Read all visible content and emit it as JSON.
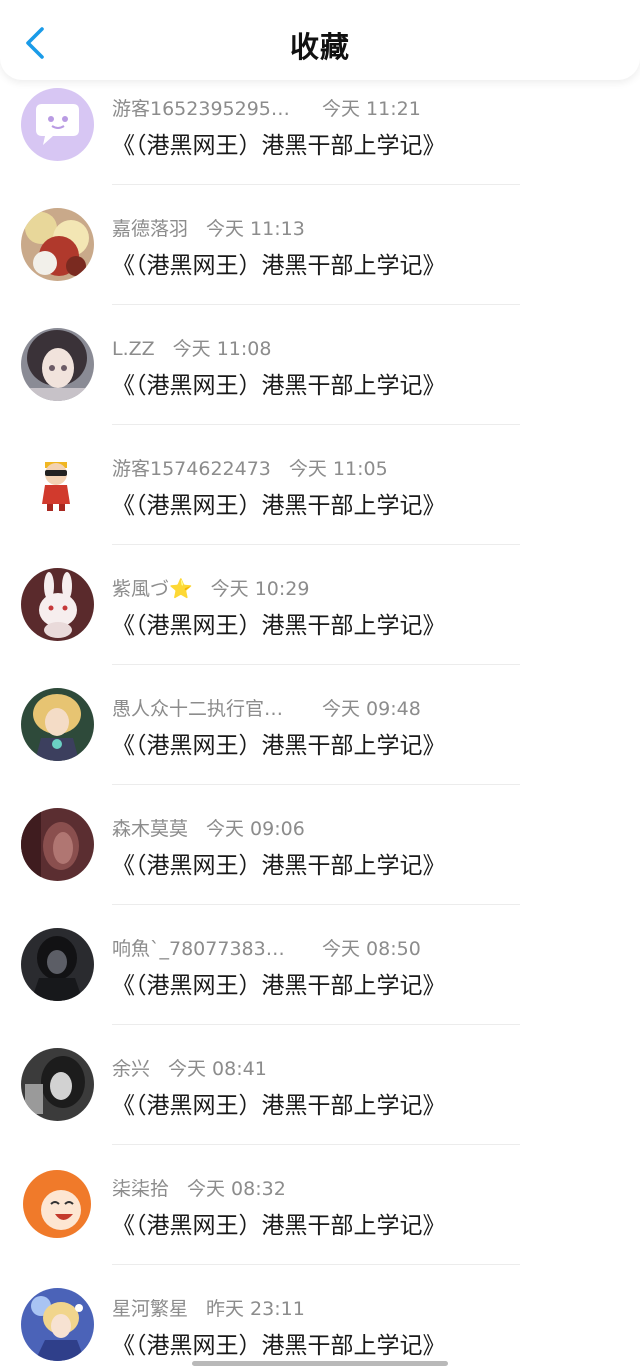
{
  "header": {
    "title": "收藏",
    "back_icon": "chevron-left-icon",
    "accent_color": "#1a9be8"
  },
  "items": [
    {
      "username": "游客1652395295…",
      "time": "今天  11:21",
      "book": "《（港黑网王）港黑干部上学记》",
      "avatar": "chat-bubble-avatar"
    },
    {
      "username": "嘉德落羽",
      "time": "今天  11:13",
      "book": "《（港黑网王）港黑干部上学记》",
      "avatar": "anime-blonde-girl-avatar"
    },
    {
      "username": "L.ZZ",
      "time": "今天  11:08",
      "book": "《（港黑网王）港黑干部上学记》",
      "avatar": "anime-dark-hair-girl-avatar"
    },
    {
      "username": "游客1574622473",
      "time": "今天  11:05",
      "book": "《（港黑网王）港黑干部上学记》",
      "avatar": "cartoon-boy-sunglasses-avatar"
    },
    {
      "username": "紫風づ⭐",
      "time": "今天  10:29",
      "book": "《（港黑网王）港黑干部上学记》",
      "avatar": "white-rabbit-avatar"
    },
    {
      "username": "愚人众十二执行官…",
      "time": "今天  09:48",
      "book": "《（港黑网王）港黑干部上学记》",
      "avatar": "anime-blonde-character-avatar"
    },
    {
      "username": "森木莫莫",
      "time": "今天  09:06",
      "book": "《（港黑网王）港黑干部上学记》",
      "avatar": "dark-red-portrait-avatar"
    },
    {
      "username": "响魚`_78077383…",
      "time": "今天  08:50",
      "book": "《（港黑网王）港黑干部上学记》",
      "avatar": "dark-hooded-figure-avatar"
    },
    {
      "username": "余兴",
      "time": "今天  08:41",
      "book": "《（港黑网王）港黑干部上学记》",
      "avatar": "grayscale-portrait-avatar"
    },
    {
      "username": "柒柒拾",
      "time": "今天  08:32",
      "book": "《（港黑网王）港黑干部上学记》",
      "avatar": "orange-hair-laughing-avatar"
    },
    {
      "username": "星河繁星",
      "time": "昨天  23:11",
      "book": "《（港黑网王）港黑干部上学记》",
      "avatar": "anime-blue-sparkle-avatar"
    }
  ]
}
